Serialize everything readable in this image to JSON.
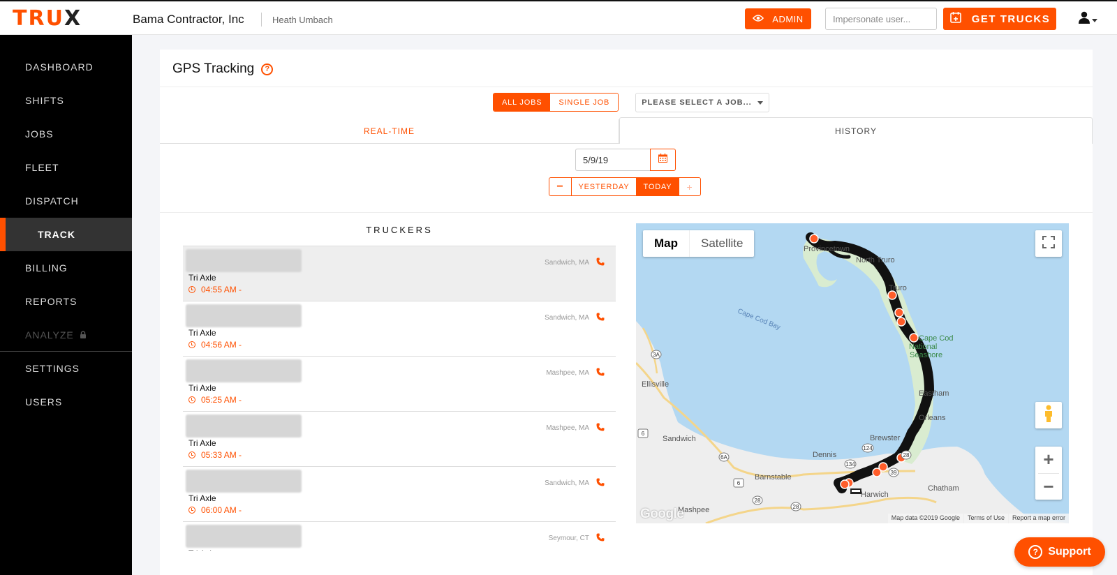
{
  "brand": {
    "logo_main": "TRU",
    "logo_x": "X",
    "accent": "#ff5000"
  },
  "header": {
    "company": "Bama Contractor, Inc",
    "user_name": "Heath Umbach",
    "admin_label": "ADMIN",
    "impersonate_placeholder": "Impersonate user...",
    "get_trucks_label": "GET TRUCKS"
  },
  "sidebar": {
    "items": [
      {
        "label": "DASHBOARD"
      },
      {
        "label": "SHIFTS"
      },
      {
        "label": "JOBS"
      },
      {
        "label": "FLEET"
      },
      {
        "label": "DISPATCH"
      },
      {
        "label": "TRACK",
        "active": true
      },
      {
        "label": "BILLING"
      },
      {
        "label": "REPORTS"
      },
      {
        "label": "ANALYZE",
        "locked": true
      },
      {
        "label": "SETTINGS"
      },
      {
        "label": "USERS"
      }
    ]
  },
  "page": {
    "title": "GPS Tracking",
    "job_scope": {
      "all_label": "ALL JOBS",
      "single_label": "SINGLE JOB",
      "selected": "ALL JOBS"
    },
    "job_select_placeholder": "PLEASE SELECT A JOB...",
    "tabs": {
      "realtime": "REAL-TIME",
      "history": "HISTORY",
      "active": "HISTORY"
    },
    "date_value": "5/9/19",
    "day_nav": {
      "minus": "−",
      "yesterday": "YESTERDAY",
      "today": "TODAY",
      "plus": "+"
    }
  },
  "truckers": {
    "title": "TRUCKERS",
    "rows": [
      {
        "type": "Tri Axle",
        "time": "04:55 AM -",
        "location": "Sandwich, MA",
        "selected": true
      },
      {
        "type": "Tri Axle",
        "time": "04:56 AM -",
        "location": "Sandwich, MA"
      },
      {
        "type": "Tri Axle",
        "time": "05:25 AM -",
        "location": "Mashpee, MA"
      },
      {
        "type": "Tri Axle",
        "time": "05:33 AM -",
        "location": "Mashpee, MA"
      },
      {
        "type": "Tri Axle",
        "time": "06:00 AM -",
        "location": "Sandwich, MA"
      },
      {
        "type": "Tri Axle",
        "time": "",
        "location": "Seymour, CT"
      }
    ]
  },
  "map": {
    "type_map": "Map",
    "type_satellite": "Satellite",
    "selected_type": "Map",
    "labels": {
      "bay": "Cape Cod Bay",
      "ellisville": "Ellisville",
      "sandwich": "Sandwich",
      "barnstable": "Barnstable",
      "dennis": "Dennis",
      "brewster": "Brewster",
      "harwich": "Harwich",
      "chatham": "Chatham",
      "mashpee": "Mashpee",
      "eastham": "Eastham",
      "orleans": "Orleans",
      "north_truro": "North Truro",
      "truro": "Truro",
      "provincetown": "Provincetown",
      "seashore1": "Cape Cod",
      "seashore2": "National",
      "seashore3": "Seashore"
    },
    "route_shields": [
      "3A",
      "6",
      "6A",
      "6",
      "28",
      "28",
      "134",
      "124",
      "28",
      "39"
    ],
    "google": "Google",
    "attribution": "Map data ©2019 Google",
    "terms": "Terms of Use",
    "report": "Report a map error",
    "zoom_in": "+",
    "zoom_out": "−"
  },
  "support_label": "Support"
}
